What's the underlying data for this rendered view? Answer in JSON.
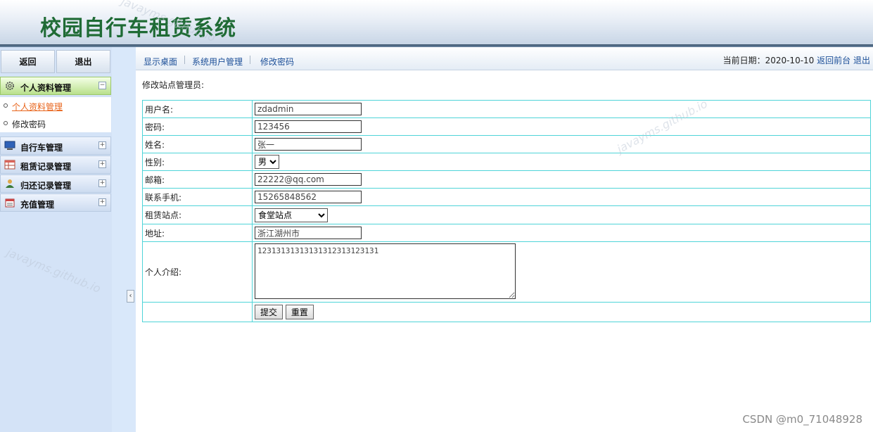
{
  "header": {
    "title": "校园自行车租赁系统"
  },
  "sidebar": {
    "top_buttons": [
      "返回",
      "退出"
    ],
    "sections": [
      {
        "label": "个人资料管理",
        "icon": "gear-icon",
        "expanded": true,
        "toggle": "−"
      },
      {
        "label": "自行车管理",
        "icon": "monitor-icon",
        "expanded": false,
        "toggle": "+"
      },
      {
        "label": "租赁记录管理",
        "icon": "table-icon",
        "expanded": false,
        "toggle": "+"
      },
      {
        "label": "归还记录管理",
        "icon": "user-icon",
        "expanded": false,
        "toggle": "+"
      },
      {
        "label": "充值管理",
        "icon": "calendar-icon",
        "expanded": false,
        "toggle": "+"
      }
    ],
    "sub_items": [
      "个人资料管理",
      "修改密码"
    ],
    "collapse_glyph": "‹"
  },
  "topnav": {
    "links": [
      "显示桌面",
      "系统用户管理",
      "修改密码"
    ],
    "date_label": "当前日期：2020-10-10",
    "back_link": "返回前台",
    "logout_link": "退出"
  },
  "form": {
    "heading": "修改站点管理员:",
    "labels": {
      "username": "用户名:",
      "password": "密码:",
      "name": "姓名:",
      "gender": "性别:",
      "email": "邮箱:",
      "phone": "联系手机:",
      "station": "租赁站点:",
      "address": "地址:",
      "intro": "个人介绍:"
    },
    "values": {
      "username": "zdadmin",
      "password": "123456",
      "name": "张一",
      "gender": "男",
      "email": "22222@qq.com",
      "phone": "15265848562",
      "station": "食堂站点",
      "address": "浙江湖州市",
      "intro": "12313131313131312313123131"
    },
    "submit_label": "提交",
    "reset_label": "重置"
  },
  "watermarks": [
    "javayms.github.io",
    "javayms.github.io",
    "javayms.github.io"
  ],
  "footer_watermark": "CSDN @m0_71048928",
  "colors": {
    "title_green": "#1f6b35",
    "link_blue": "#1c4f98",
    "active_link": "#e8641b",
    "table_border": "#4fd4d8"
  }
}
